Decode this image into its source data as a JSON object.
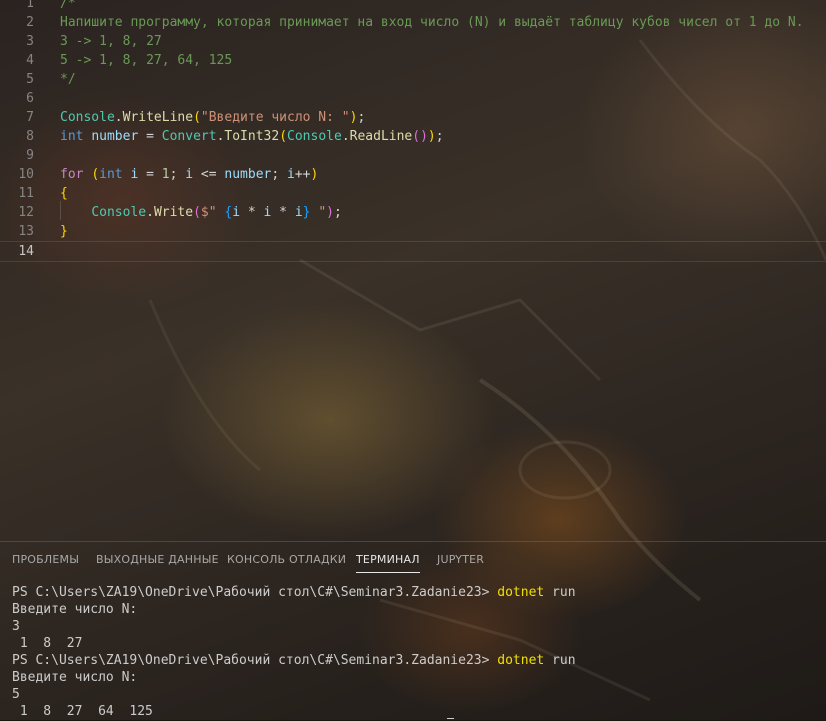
{
  "editor": {
    "lines": [
      {
        "num": "1",
        "segments": [
          {
            "cls": "cmt",
            "text": "/*"
          }
        ]
      },
      {
        "num": "2",
        "segments": [
          {
            "cls": "cmt",
            "text": "Напишите программу, которая принимает на вход число (N) и выдаёт таблицу кубов чисел от 1 до N."
          }
        ]
      },
      {
        "num": "3",
        "segments": [
          {
            "cls": "cmt",
            "text": "3 -> 1, 8, 27"
          }
        ]
      },
      {
        "num": "4",
        "segments": [
          {
            "cls": "cmt",
            "text": "5 -> 1, 8, 27, 64, 125"
          }
        ]
      },
      {
        "num": "5",
        "segments": [
          {
            "cls": "cmt",
            "text": "*/"
          }
        ]
      },
      {
        "num": "6",
        "segments": []
      },
      {
        "num": "7",
        "segments": [
          {
            "cls": "cls",
            "text": "Console"
          },
          {
            "cls": "pl",
            "text": "."
          },
          {
            "cls": "fn",
            "text": "WriteLine"
          },
          {
            "cls": "b1",
            "text": "("
          },
          {
            "cls": "str",
            "text": "\"Введите число N: \""
          },
          {
            "cls": "b1",
            "text": ")"
          },
          {
            "cls": "pl",
            "text": ";"
          }
        ]
      },
      {
        "num": "8",
        "segments": [
          {
            "cls": "kw",
            "text": "int"
          },
          {
            "cls": "pl",
            "text": " "
          },
          {
            "cls": "id",
            "text": "number"
          },
          {
            "cls": "pl",
            "text": " = "
          },
          {
            "cls": "cls",
            "text": "Convert"
          },
          {
            "cls": "pl",
            "text": "."
          },
          {
            "cls": "fn",
            "text": "ToInt32"
          },
          {
            "cls": "b1",
            "text": "("
          },
          {
            "cls": "cls",
            "text": "Console"
          },
          {
            "cls": "pl",
            "text": "."
          },
          {
            "cls": "fn",
            "text": "ReadLine"
          },
          {
            "cls": "b2",
            "text": "()"
          },
          {
            "cls": "b1",
            "text": ")"
          },
          {
            "cls": "pl",
            "text": ";"
          }
        ]
      },
      {
        "num": "9",
        "segments": []
      },
      {
        "num": "10",
        "segments": [
          {
            "cls": "ctl",
            "text": "for"
          },
          {
            "cls": "pl",
            "text": " "
          },
          {
            "cls": "b1",
            "text": "("
          },
          {
            "cls": "kw",
            "text": "int"
          },
          {
            "cls": "pl",
            "text": " "
          },
          {
            "cls": "id",
            "text": "i"
          },
          {
            "cls": "pl",
            "text": " = "
          },
          {
            "cls": "num",
            "text": "1"
          },
          {
            "cls": "pl",
            "text": "; "
          },
          {
            "cls": "id",
            "text": "i"
          },
          {
            "cls": "pl",
            "text": " <= "
          },
          {
            "cls": "id",
            "text": "number"
          },
          {
            "cls": "pl",
            "text": "; "
          },
          {
            "cls": "id",
            "text": "i"
          },
          {
            "cls": "pl",
            "text": "++"
          },
          {
            "cls": "b1",
            "text": ")"
          }
        ]
      },
      {
        "num": "11",
        "segments": [
          {
            "cls": "b1",
            "text": "{"
          }
        ]
      },
      {
        "num": "12",
        "segments": [
          {
            "cls": "pl",
            "text": "    "
          },
          {
            "cls": "cls",
            "text": "Console"
          },
          {
            "cls": "pl",
            "text": "."
          },
          {
            "cls": "fn",
            "text": "Write"
          },
          {
            "cls": "b2",
            "text": "("
          },
          {
            "cls": "str",
            "text": "$\" "
          },
          {
            "cls": "b3",
            "text": "{"
          },
          {
            "cls": "id",
            "text": "i"
          },
          {
            "cls": "pl",
            "text": " * "
          },
          {
            "cls": "id",
            "text": "i"
          },
          {
            "cls": "pl",
            "text": " * "
          },
          {
            "cls": "id",
            "text": "i"
          },
          {
            "cls": "b3",
            "text": "}"
          },
          {
            "cls": "str",
            "text": " \""
          },
          {
            "cls": "b2",
            "text": ")"
          },
          {
            "cls": "pl",
            "text": ";"
          }
        ]
      },
      {
        "num": "13",
        "segments": [
          {
            "cls": "b1",
            "text": "}"
          }
        ]
      },
      {
        "num": "14",
        "segments": [],
        "active": true
      }
    ]
  },
  "panel": {
    "tabs": [
      {
        "label": "ПРОБЛЕМЫ",
        "name": "tab-problems",
        "active": false
      },
      {
        "label": "ВЫХОДНЫЕ ДАННЫЕ",
        "name": "tab-output",
        "active": false
      },
      {
        "label": "КОНСОЛЬ ОТЛАДКИ",
        "name": "tab-debug-console",
        "active": false
      },
      {
        "label": "ТЕРМИНАЛ",
        "name": "tab-terminal",
        "active": true
      },
      {
        "label": "JUPYTER",
        "name": "tab-jupyter",
        "active": false
      }
    ],
    "terminal": [
      {
        "prompt": "PS C:\\Users\\ZA19\\OneDrive\\Рабочий стол\\C#\\Seminar3.Zadanie23> ",
        "cmd": "dotnet",
        "args": " run"
      },
      {
        "text": "Введите число N:"
      },
      {
        "text": "3"
      },
      {
        "text": " 1  8  27 "
      },
      {
        "prompt": "PS C:\\Users\\ZA19\\OneDrive\\Рабочий стол\\C#\\Seminar3.Zadanie23> ",
        "cmd": "dotnet",
        "args": " run"
      },
      {
        "text": "Введите число N:"
      },
      {
        "text": "5"
      },
      {
        "text": " 1  8  27  64  125 "
      }
    ]
  }
}
